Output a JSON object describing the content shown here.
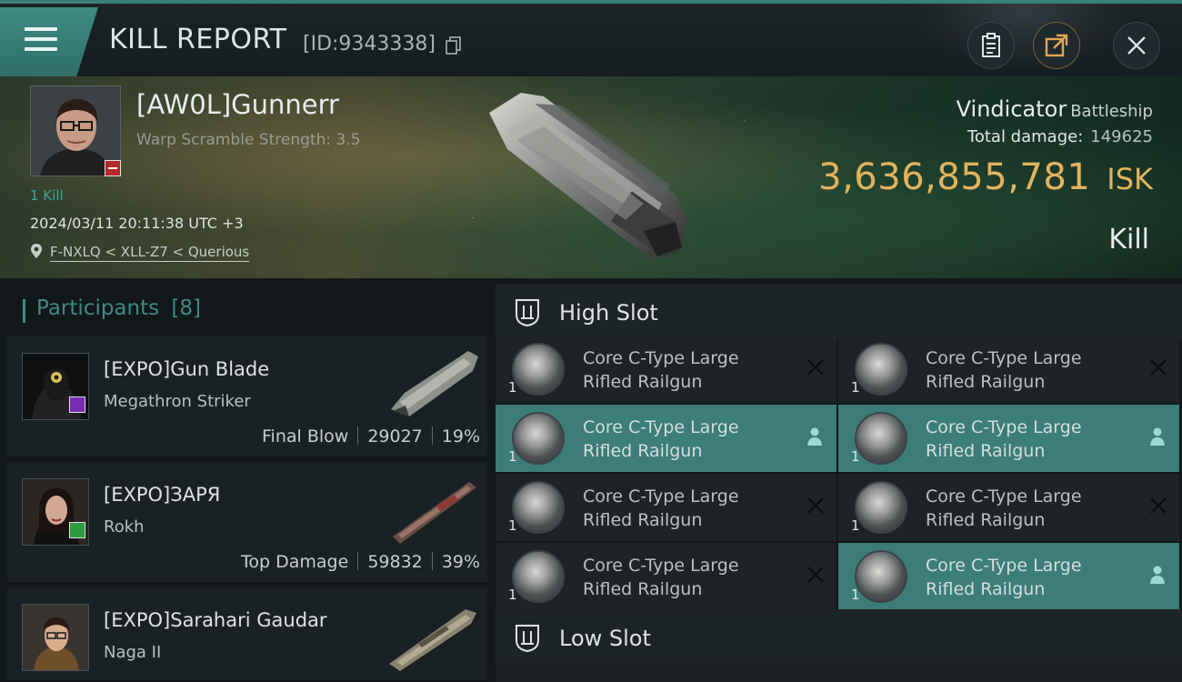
{
  "header": {
    "title": "KILL REPORT",
    "report_id": "[ID:9343338]"
  },
  "victim": {
    "name": "[AW0L]Gunnerr",
    "warp_scramble": "Warp Scramble Strength: 3.5",
    "kills": "1 Kill",
    "datetime": "2024/03/11 20:11:38 UTC +3",
    "location": "F-NXLQ < XLL-Z7 < Querious",
    "ship_name": "Vindicator",
    "ship_class": "Battleship",
    "total_damage_label": "Total damage:",
    "total_damage_value": "149625",
    "isk_value": "3,636,855,781",
    "isk_unit": "ISK",
    "result": "Kill"
  },
  "participants": {
    "label": "Participants",
    "count": "[8]",
    "rows": [
      {
        "name": "[EXPO]Gun Blade",
        "ship": "Megathron Striker",
        "tag": "Final Blow",
        "damage": "29027",
        "percent": "19%",
        "badge_color": "#7a2bb5"
      },
      {
        "name": "[EXPO]ЗАРЯ",
        "ship": "Rokh",
        "tag": "Top Damage",
        "damage": "59832",
        "percent": "39%",
        "badge_color": "#2d9a3e"
      },
      {
        "name": "[EXPO]Sarahari Gaudar",
        "ship": "Naga II",
        "tag": "",
        "damage": "",
        "percent": "",
        "badge_color": ""
      }
    ]
  },
  "fitting": {
    "high_slot_label": "High Slot",
    "low_slot_label": "Low Slot",
    "modules": [
      {
        "line1": "Core C-Type Large",
        "line2": "Rifled Railgun",
        "qty": "1",
        "state": "destroyed"
      },
      {
        "line1": "Core C-Type Large",
        "line2": "Rifled Railgun",
        "qty": "1",
        "state": "destroyed"
      },
      {
        "line1": "Core C-Type Large",
        "line2": "Rifled Railgun",
        "qty": "1",
        "state": "dropped"
      },
      {
        "line1": "Core C-Type Large",
        "line2": "Rifled Railgun",
        "qty": "1",
        "state": "dropped"
      },
      {
        "line1": "Core C-Type Large",
        "line2": "Rifled Railgun",
        "qty": "1",
        "state": "destroyed"
      },
      {
        "line1": "Core C-Type Large",
        "line2": "Rifled Railgun",
        "qty": "1",
        "state": "destroyed"
      },
      {
        "line1": "Core C-Type Large",
        "line2": "Rifled Railgun",
        "qty": "1",
        "state": "destroyed"
      },
      {
        "line1": "Core C-Type Large",
        "line2": "Rifled Railgun",
        "qty": "1",
        "state": "dropped"
      }
    ]
  },
  "colors": {
    "accent": "#3f8b86",
    "isk": "#e3b35d",
    "dropped_bg": "#3c7d78"
  },
  "icons": {
    "menu": "hamburger-icon",
    "copy": "copy-icon",
    "clipboard": "clipboard-icon",
    "share": "share-icon",
    "close": "close-icon",
    "location": "location-pin-icon",
    "slot": "slot-icon",
    "destroyed": "x-icon",
    "dropped": "person-icon"
  }
}
